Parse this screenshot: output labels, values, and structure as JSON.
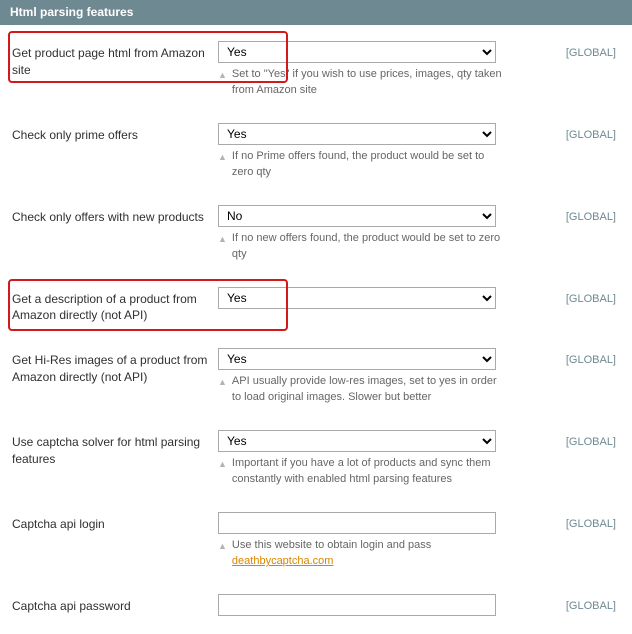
{
  "header": {
    "title": "Html parsing features"
  },
  "scope_label": "[GLOBAL]",
  "hint_link_text": "deathbycaptcha.com",
  "rows": [
    {
      "label": "Get product page html from Amazon site",
      "type": "select",
      "value": "Yes",
      "hint": "Set to \"Yes\" if you wish to use prices, images, qty taken from Amazon site"
    },
    {
      "label": "Check only prime offers",
      "type": "select",
      "value": "Yes",
      "hint": "If no Prime offers found, the product would be set to zero qty"
    },
    {
      "label": "Check only offers with new products",
      "type": "select",
      "value": "No",
      "hint": "If no new offers found, the product would be set to zero qty"
    },
    {
      "label": "Get a description of a product from Amazon directly (not API)",
      "type": "select",
      "value": "Yes",
      "hint": ""
    },
    {
      "label": "Get Hi-Res images of a product from Amazon directly (not API)",
      "type": "select",
      "value": "Yes",
      "hint": "API usually provide low-res images, set to yes in order to load original images. Slower but better"
    },
    {
      "label": "Use captcha solver for html parsing features",
      "type": "select",
      "value": "Yes",
      "hint": "Important if you have a lot of products and sync them constantly with enabled html parsing features"
    },
    {
      "label": "Captcha api login",
      "type": "text",
      "value": "",
      "hint": "Use this website to obtain login and pass ",
      "hint_link": true
    },
    {
      "label": "Captcha api password",
      "type": "text",
      "value": "",
      "hint": ""
    }
  ]
}
